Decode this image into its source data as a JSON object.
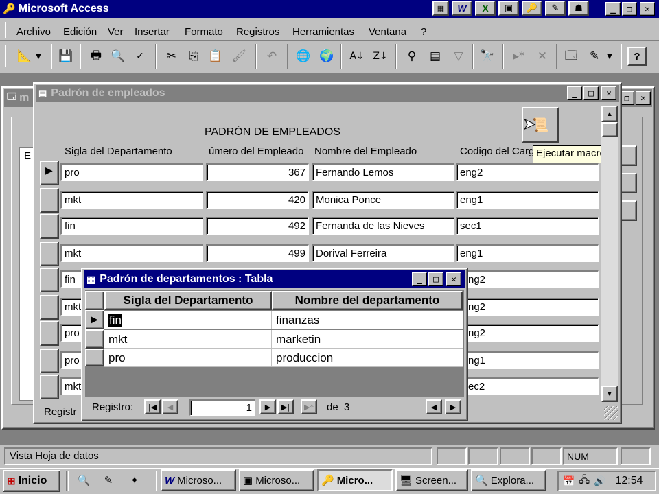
{
  "app": {
    "title": "Microsoft Access"
  },
  "menu": [
    "Archivo",
    "Edición",
    "Ver",
    "Insertar",
    "Formato",
    "Registros",
    "Herramientas",
    "Ventana",
    "?"
  ],
  "form": {
    "window_title": "Padrón de empleados",
    "heading": "PADRÓN DE EMPLEADOS",
    "columns": [
      "Sigla del Departamento",
      "úmero del Empleado",
      "Nombre del Empleado",
      "Codigo del Carg"
    ],
    "rows": [
      [
        "pro",
        "367",
        "Fernando Lemos",
        "eng2"
      ],
      [
        "mkt",
        "420",
        "Monica Ponce",
        "eng1"
      ],
      [
        "fin",
        "492",
        "Fernanda de las Nieves",
        "sec1"
      ],
      [
        "mkt",
        "499",
        "Dorival Ferreira",
        "eng1"
      ],
      [
        "fin",
        "",
        "",
        "ng2"
      ],
      [
        "mkt",
        "",
        "",
        "ng2"
      ],
      [
        "pro",
        "",
        "",
        "ng2"
      ],
      [
        "pro",
        "",
        "",
        "ng1"
      ],
      [
        "mkt",
        "",
        "",
        "ec2"
      ]
    ],
    "tooltip": "Ejecutar macro",
    "record_label": "Registr",
    "background_window_title": "m"
  },
  "table": {
    "window_title": "Padrón de departamentos : Tabla",
    "columns": [
      "Sigla del Departamento",
      "Nombre del departamento"
    ],
    "rows": [
      [
        "fin",
        "finanzas"
      ],
      [
        "mkt",
        "marketin"
      ],
      [
        "pro",
        "produccion"
      ]
    ],
    "nav": {
      "label": "Registro:",
      "current": "1",
      "of": "de  3"
    }
  },
  "status": {
    "text": "Vista Hoja de datos",
    "num": "NUM"
  },
  "taskbar": {
    "start": "Inicio",
    "tasks": [
      "Microso...",
      "Microso...",
      "Micro...",
      "Screen...",
      "Explora..."
    ],
    "clock": "12:54"
  },
  "icons": {
    "app": "key-icon",
    "form": "form-icon",
    "table": "table-icon"
  }
}
